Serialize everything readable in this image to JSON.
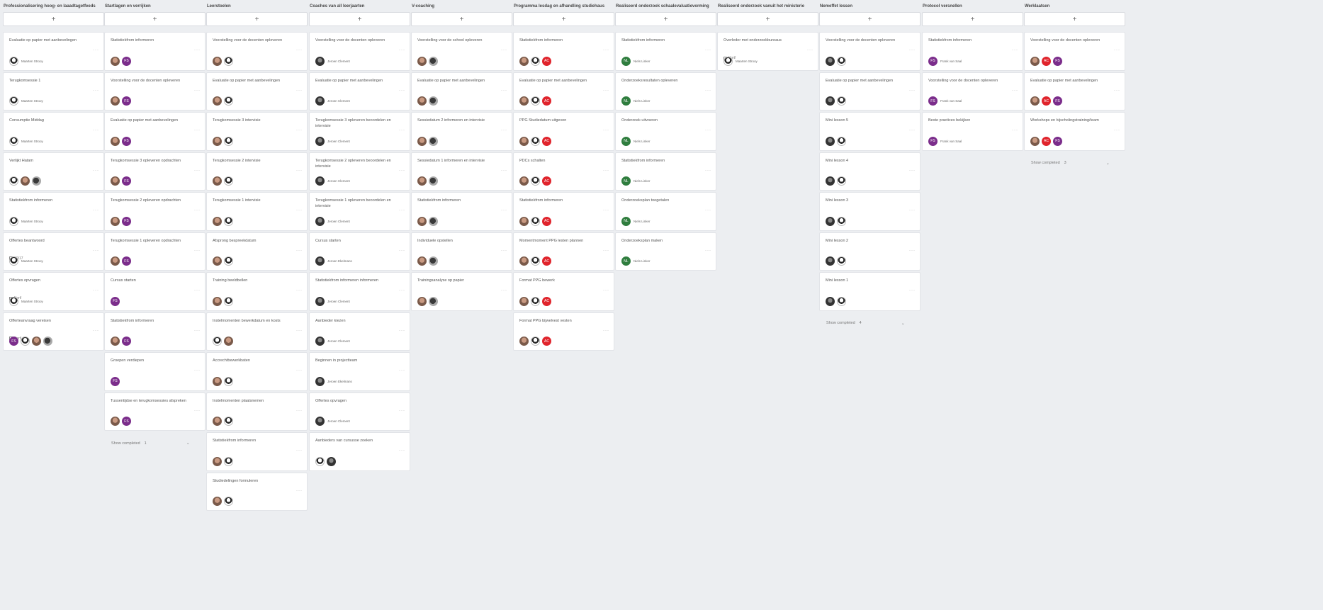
{
  "board": {
    "add_label": "+",
    "more_label": "···",
    "show_completed_label": "Show completed",
    "avatar_names": {
      "m": "Maarten Strooy",
      "ja": "Jeroen Clement",
      "j": "Jeroen Ekelmans",
      "n": "Niels Linker",
      "f": "Frank van Saal"
    },
    "columns": [
      {
        "title": "Professionalisering hoog- en laaadtagetfeeds",
        "cards": [
          {
            "title": "Evaluatie op papier met aanbevelingen",
            "avatars": [
              "bw"
            ],
            "assignee": "m"
          },
          {
            "title": "Terugkomsessie 1",
            "avatars": [
              "bw"
            ],
            "assignee": "m"
          },
          {
            "title": "Consumptie Middag",
            "avatars": [
              "bw"
            ],
            "assignee": "m"
          },
          {
            "title": "Verlijkt Hatam",
            "avatars": [
              "bw",
              "photo",
              "plant"
            ]
          },
          {
            "title": "Statistiekfrom informeren",
            "avatars": [
              "bw"
            ],
            "assignee": "m"
          },
          {
            "title": "Offertes beantwoord",
            "meta": "10/17",
            "avatars": [
              "bw"
            ],
            "assignee": "m"
          },
          {
            "title": "Offertes opvragen",
            "meta": "Kort!",
            "avatars": [
              "bw"
            ],
            "assignee": "m"
          },
          {
            "title": "Offerteanvraag vereisen",
            "meta": "Kort!",
            "avatars": [
              "purple",
              "bw",
              "photo",
              "plant"
            ]
          }
        ]
      },
      {
        "title": "Startlagen en verrijken",
        "completed": "1",
        "cards": [
          {
            "title": "Statistiekfrom informeren",
            "avatars": [
              "photo",
              "purple"
            ]
          },
          {
            "title": "Voorstelling voor de docenten opleveren",
            "avatars": [
              "photo",
              "purple"
            ]
          },
          {
            "title": "Evaluatie op papier met aanbevelingen",
            "avatars": [
              "photo",
              "purple"
            ]
          },
          {
            "title": "Terugkomsessie 3 opleveren opdrachten",
            "avatars": [
              "photo",
              "purple"
            ]
          },
          {
            "title": "Terugkomsessie 2 opleveren opdrachten",
            "avatars": [
              "photo",
              "purple"
            ]
          },
          {
            "title": "Terugkomsessie 1 opleveren opdrachten",
            "avatars": [
              "photo",
              "purple"
            ]
          },
          {
            "title": "Cursus starten",
            "avatars": [
              "purple"
            ]
          },
          {
            "title": "Statistiekfrom informeren",
            "avatars": [
              "photo",
              "purple"
            ]
          },
          {
            "title": "Groepen verdiepen",
            "avatars": [
              "purple"
            ]
          },
          {
            "title": "Tussentijdse en terugkomsessies afspreken",
            "avatars": [
              "photo",
              "purple"
            ]
          }
        ]
      },
      {
        "title": "Leerstoelen",
        "cards": [
          {
            "title": "Voorstelling voor de docenten opleveren",
            "avatars": [
              "photo",
              "bw"
            ]
          },
          {
            "title": "Evaluatie op papier met aanbevelingen",
            "avatars": [
              "photo",
              "bw"
            ]
          },
          {
            "title": "Terugkomsessie 3 intervisie",
            "avatars": [
              "photo",
              "bw"
            ]
          },
          {
            "title": "Terugkomsessie 2 intervisie",
            "avatars": [
              "photo",
              "bw"
            ]
          },
          {
            "title": "Terugkomsessie 1 intervisie",
            "avatars": [
              "photo",
              "bw"
            ]
          },
          {
            "title": "Afsprong bespreekdatum",
            "avatars": [
              "photo",
              "bw"
            ]
          },
          {
            "title": "Training beeldbellen",
            "avatars": [
              "photo",
              "bw"
            ]
          },
          {
            "title": "Instelmomenten bewerkdatum en kosts",
            "avatars": [
              "bw",
              "photo"
            ]
          },
          {
            "title": "Accrechtbewerkbaten",
            "avatars": [
              "photo",
              "bw"
            ]
          },
          {
            "title": "Instelmomenten plaatsnemen",
            "avatars": [
              "photo",
              "bw"
            ]
          },
          {
            "title": "Statistiekfrom informeren",
            "avatars": [
              "photo",
              "bw"
            ]
          },
          {
            "title": "Studiedelingen formuleren",
            "avatars": [
              "photo",
              "bw"
            ]
          }
        ]
      },
      {
        "title": "Coaches van all leerjaarten",
        "cards": [
          {
            "title": "Voorstelling voor de docenten opleveren",
            "avatars": [
              "dark"
            ],
            "assignee": "ja"
          },
          {
            "title": "Evaluatie op papier met aanbevelingen",
            "avatars": [
              "dark"
            ],
            "assignee": "ja"
          },
          {
            "title": "Terugkomsessie 3 opleveren beoordelen en intervisie",
            "avatars": [
              "dark"
            ],
            "assignee": "ja"
          },
          {
            "title": "Terugkomsessie 2 opleveren beoordelen en intervisie",
            "avatars": [
              "dark"
            ],
            "assignee": "ja"
          },
          {
            "title": "Terugkomsessie 1 opleveren beoordelen en intervisie",
            "avatars": [
              "dark"
            ],
            "assignee": "ja"
          },
          {
            "title": "Cursus starten",
            "avatars": [
              "dark"
            ],
            "assignee": "j"
          },
          {
            "title": "Statistiekfrom informeren informeren",
            "avatars": [
              "dark"
            ],
            "assignee": "ja"
          },
          {
            "title": "Aanbieder kiezen",
            "avatars": [
              "dark"
            ],
            "assignee": "ja"
          },
          {
            "title": "Beginnen in projectteam",
            "avatars": [
              "dark"
            ],
            "assignee": "j"
          },
          {
            "title": "Offertes opvragen",
            "avatars": [
              "dark"
            ],
            "assignee": "ja"
          },
          {
            "title": "Aanbieders van cursusse zoeken",
            "avatars": [
              "bw",
              "dark"
            ]
          }
        ]
      },
      {
        "title": "V-coaching",
        "cards": [
          {
            "title": "Voorstelling voor de school opleveren",
            "avatars": [
              "photo",
              "plant"
            ]
          },
          {
            "title": "Evaluatie op papier met aanbevelingen",
            "avatars": [
              "photo",
              "plant"
            ]
          },
          {
            "title": "Sessiedatum 2 informeren en intervisie",
            "avatars": [
              "photo",
              "plant"
            ]
          },
          {
            "title": "Sessiedatum 1 informeren en intervisie",
            "avatars": [
              "photo",
              "plant"
            ]
          },
          {
            "title": "Statistiekfrom informeren",
            "avatars": [
              "photo",
              "plant"
            ]
          },
          {
            "title": "Individuele opstellen",
            "avatars": [
              "photo",
              "plant"
            ]
          },
          {
            "title": "Trainingsanalyse op papier",
            "avatars": [
              "photo",
              "plant"
            ]
          }
        ]
      },
      {
        "title": "Programma lesdag en afhandling studiehaus",
        "cards": [
          {
            "title": "Statistiekfrom informeren",
            "avatars": [
              "photo",
              "bw",
              "red"
            ]
          },
          {
            "title": "Evaluatie op papier met aanbevelingen",
            "avatars": [
              "photo",
              "bw",
              "red"
            ]
          },
          {
            "title": "PPG Studiedatum uitgeven",
            "avatars": [
              "photo",
              "bw",
              "red"
            ]
          },
          {
            "title": "PDCs schalten",
            "avatars": [
              "photo",
              "bw",
              "red"
            ]
          },
          {
            "title": "Statistiekfrom informeren",
            "avatars": [
              "photo",
              "bw",
              "red"
            ]
          },
          {
            "title": "Momentmoment PPG lesten plannen",
            "avatars": [
              "photo",
              "bw",
              "red"
            ]
          },
          {
            "title": "Format PPG bewerk",
            "avatars": [
              "photo",
              "bw",
              "red"
            ]
          },
          {
            "title": "Format PPG bijwelvest vesten",
            "avatars": [
              "photo",
              "bw",
              "red"
            ]
          }
        ]
      },
      {
        "title": "Realiseerd onderzoek schaalevaluatievorming",
        "cards": [
          {
            "title": "Statistiekfrom informeren",
            "avatars": [
              "green"
            ],
            "assignee": "n"
          },
          {
            "title": "Onderzoeksresultaten opleveren",
            "avatars": [
              "green"
            ],
            "assignee": "n"
          },
          {
            "title": "Onderzoek uitvoeren",
            "avatars": [
              "green"
            ],
            "assignee": "n"
          },
          {
            "title": "Statistiekfrom informeren",
            "avatars": [
              "green"
            ],
            "assignee": "n"
          },
          {
            "title": "Onderzoeksplan toegetalen",
            "avatars": [
              "green"
            ],
            "assignee": "n"
          },
          {
            "title": "Onderzoeksplan maken",
            "avatars": [
              "green"
            ],
            "assignee": "n"
          }
        ]
      },
      {
        "title": "Realiseerd onderzoek vanuit het ministerie",
        "cards": [
          {
            "title": "Overleder met onderzoekbureaus",
            "meta": "Kort!",
            "avatars": [
              "bw"
            ],
            "assignee": "m"
          }
        ]
      },
      {
        "title": "Nemeffet lessen",
        "completed": "4",
        "cards": [
          {
            "title": "Voorstelling voor de docenten opleveren",
            "avatars": [
              "dark",
              "bw"
            ]
          },
          {
            "title": "Evaluatie op papier met aanbevelingen",
            "avatars": [
              "dark",
              "bw"
            ]
          },
          {
            "title": "Mini lesson 5",
            "avatars": [
              "dark",
              "bw"
            ]
          },
          {
            "title": "Mini lesson 4",
            "avatars": [
              "dark",
              "bw"
            ]
          },
          {
            "title": "Mini lesson 3",
            "avatars": [
              "dark",
              "bw"
            ]
          },
          {
            "title": "Mini lesson 2",
            "avatars": [
              "dark",
              "bw"
            ]
          },
          {
            "title": "Mini lesson 1",
            "avatars": [
              "dark",
              "bw"
            ]
          }
        ]
      },
      {
        "title": "Protocol versnellen",
        "cards": [
          {
            "title": "Statistiekfrom informeren",
            "avatars": [
              "purple"
            ],
            "assignee": "f"
          },
          {
            "title": "Voorstelling voor de docenten opleveren",
            "avatars": [
              "purple"
            ],
            "assignee": "f"
          },
          {
            "title": "Beste practices bekijken",
            "avatars": [
              "purple"
            ],
            "assignee": "f"
          }
        ]
      },
      {
        "title": "Werklaatsen",
        "completed": "3",
        "cards": [
          {
            "title": "Voorstelling voor de docenten opleveren",
            "avatars": [
              "photo",
              "red",
              "purple"
            ]
          },
          {
            "title": "Evaluatie op papier met aanbevelingen",
            "avatars": [
              "photo",
              "red",
              "purple"
            ]
          },
          {
            "title": "Workshops en bijscholingstraining/team",
            "avatars": [
              "photo",
              "red",
              "purple"
            ]
          }
        ]
      }
    ]
  }
}
